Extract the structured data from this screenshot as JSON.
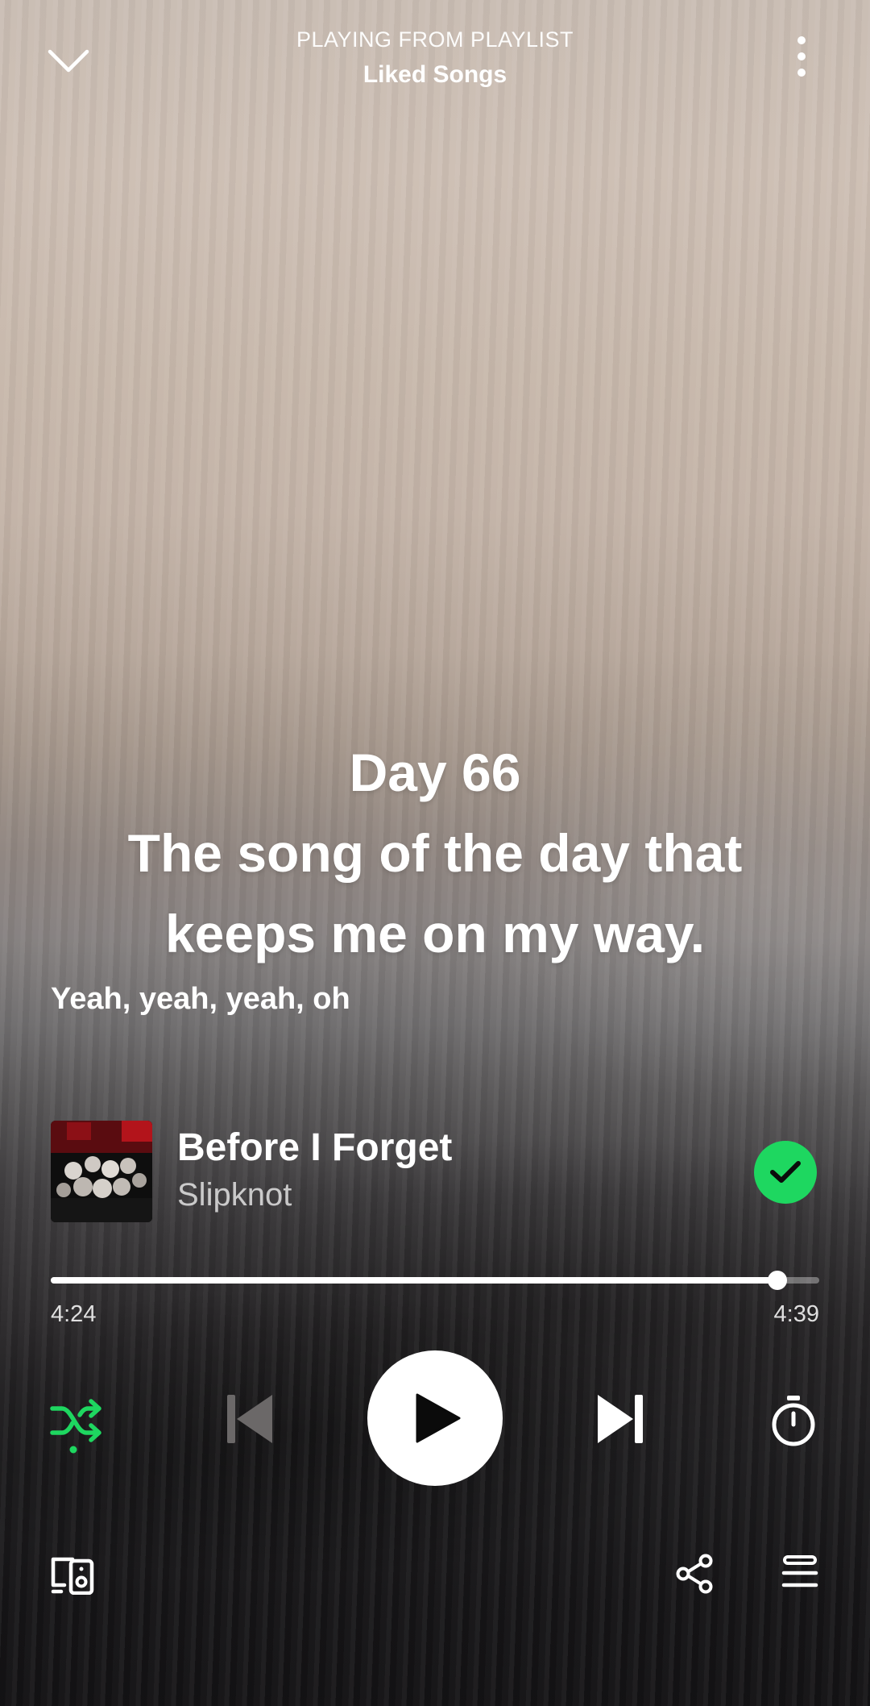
{
  "header": {
    "context_label": "PLAYING FROM PLAYLIST",
    "context_name": "Liked Songs",
    "collapse_icon": "chevron-down-icon",
    "menu_icon": "more-vertical-icon"
  },
  "lyrics_card": {
    "lines": [
      "Day 66",
      "The song of the day that",
      "keeps me on my way."
    ],
    "current_lyric": "Yeah, yeah, yeah, oh"
  },
  "track": {
    "title": "Before I Forget",
    "artist": "Slipknot",
    "liked": true,
    "liked_icon": "checkmark-icon"
  },
  "playback": {
    "elapsed": "4:24",
    "duration": "4:39",
    "progress_fraction": 0.946
  },
  "controls": {
    "shuffle_active": true,
    "shuffle_icon": "shuffle-icon",
    "previous_icon": "skip-previous-icon",
    "play_icon": "play-icon",
    "next_icon": "skip-next-icon",
    "sleep_timer_icon": "timer-icon",
    "devices_icon": "connect-devices-icon",
    "share_icon": "share-icon",
    "queue_icon": "queue-icon"
  },
  "colors": {
    "accent": "#1ed760",
    "text": "#ffffff"
  }
}
